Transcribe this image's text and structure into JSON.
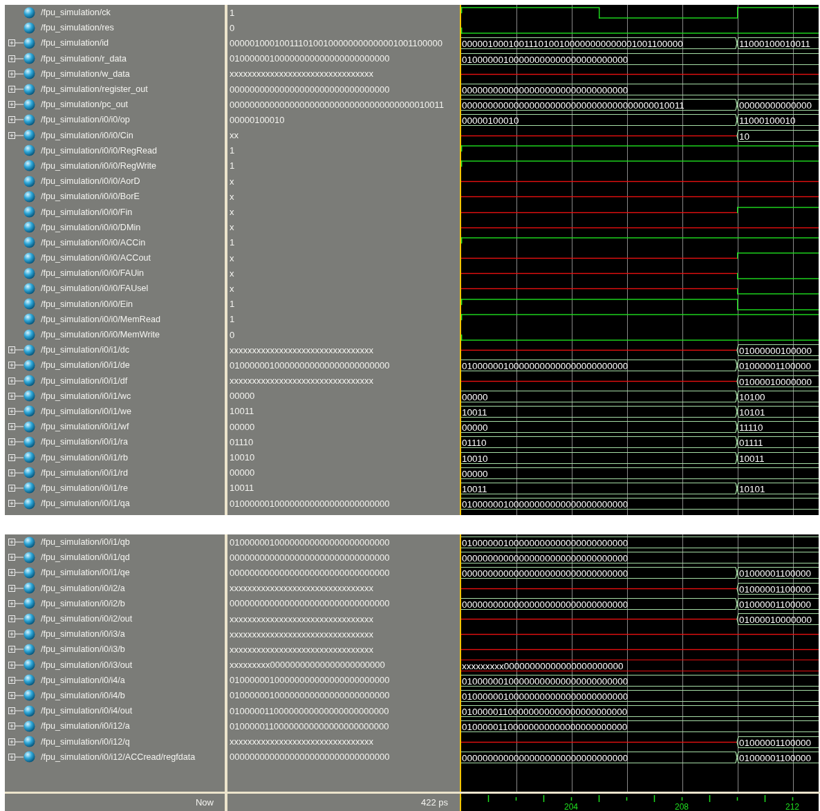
{
  "panes": [
    {
      "signals": [
        {
          "name": "/fpu_simulation/ck",
          "value": "1",
          "expandable": false,
          "kind": "bit",
          "wave": [
            {
              "unknown": false,
              "high": true
            },
            {
              "unknown": false,
              "high": false
            },
            {
              "unknown": false,
              "high": true
            }
          ]
        },
        {
          "name": "/fpu_simulation/res",
          "value": "0",
          "expandable": false,
          "kind": "bit",
          "wave": [
            {
              "unknown": false,
              "high": false
            }
          ]
        },
        {
          "name": "/fpu_simulation/id",
          "value": "0000010001001110100100000000000001001100000",
          "expandable": true,
          "kind": "bus",
          "wave": [
            {
              "unknown": false,
              "partial": false,
              "text": "0000010001001110100100000000000001001100000"
            },
            {
              "unknown": false,
              "partial": false,
              "text": "11000100010011"
            }
          ]
        },
        {
          "name": "/fpu_simulation/r_data",
          "value": "01000000100000000000000000000000",
          "expandable": true,
          "kind": "bus",
          "wave": [
            {
              "unknown": false,
              "partial": false,
              "text": "01000000100000000000000000000000"
            }
          ]
        },
        {
          "name": "/fpu_simulation/w_data",
          "value": "xxxxxxxxxxxxxxxxxxxxxxxxxxxxxxxx",
          "expandable": true,
          "kind": "bus",
          "wave": [
            {
              "unknown": true
            }
          ]
        },
        {
          "name": "/fpu_simulation/register_out",
          "value": "00000000000000000000000000000000",
          "expandable": true,
          "kind": "bus",
          "wave": [
            {
              "unknown": false,
              "partial": false,
              "text": "00000000000000000000000000000000"
            }
          ]
        },
        {
          "name": "/fpu_simulation/pc_out",
          "value": "0000000000000000000000000000000000000010011",
          "expandable": true,
          "kind": "bus",
          "wave": [
            {
              "unknown": false,
              "partial": false,
              "text": "0000000000000000000000000000000000000010011"
            },
            {
              "unknown": false,
              "partial": false,
              "text": "00000000000000"
            }
          ]
        },
        {
          "name": "/fpu_simulation/i0/i0/op",
          "value": "00000100010",
          "expandable": true,
          "kind": "bus",
          "wave": [
            {
              "unknown": false,
              "partial": false,
              "text": "00000100010"
            },
            {
              "unknown": false,
              "partial": false,
              "text": "11000100010"
            }
          ]
        },
        {
          "name": "/fpu_simulation/i0/i0/Cin",
          "value": "xx",
          "expandable": true,
          "kind": "bus",
          "wave": [
            {
              "unknown": true
            },
            {
              "unknown": false,
              "partial": false,
              "text": "10"
            }
          ]
        },
        {
          "name": "/fpu_simulation/i0/i0/RegRead",
          "value": "1",
          "expandable": false,
          "kind": "bit",
          "wave": [
            {
              "unknown": false,
              "high": true
            }
          ]
        },
        {
          "name": "/fpu_simulation/i0/i0/RegWrite",
          "value": "1",
          "expandable": false,
          "kind": "bit",
          "wave": [
            {
              "unknown": false,
              "high": true
            }
          ]
        },
        {
          "name": "/fpu_simulation/i0/i0/AorD",
          "value": "x",
          "expandable": false,
          "kind": "bit",
          "wave": [
            {
              "unknown": true
            }
          ]
        },
        {
          "name": "/fpu_simulation/i0/i0/BorE",
          "value": "x",
          "expandable": false,
          "kind": "bit",
          "wave": [
            {
              "unknown": true
            }
          ]
        },
        {
          "name": "/fpu_simulation/i0/i0/Fin",
          "value": "x",
          "expandable": false,
          "kind": "bit",
          "wave": [
            {
              "unknown": true
            },
            {
              "unknown": false,
              "high": true
            }
          ]
        },
        {
          "name": "/fpu_simulation/i0/i0/DMin",
          "value": "x",
          "expandable": false,
          "kind": "bit",
          "wave": [
            {
              "unknown": true
            }
          ]
        },
        {
          "name": "/fpu_simulation/i0/i0/ACCin",
          "value": "1",
          "expandable": false,
          "kind": "bit",
          "wave": [
            {
              "unknown": false,
              "high": true
            }
          ]
        },
        {
          "name": "/fpu_simulation/i0/i0/ACCout",
          "value": "x",
          "expandable": false,
          "kind": "bit",
          "wave": [
            {
              "unknown": true
            },
            {
              "unknown": false,
              "high": true
            }
          ]
        },
        {
          "name": "/fpu_simulation/i0/i0/FAUin",
          "value": "x",
          "expandable": false,
          "kind": "bit",
          "wave": [
            {
              "unknown": true
            },
            {
              "unknown": false,
              "high": false
            }
          ]
        },
        {
          "name": "/fpu_simulation/i0/i0/FAUsel",
          "value": "x",
          "expandable": false,
          "kind": "bit",
          "wave": [
            {
              "unknown": true
            },
            {
              "unknown": false,
              "high": false
            }
          ]
        },
        {
          "name": "/fpu_simulation/i0/i0/Ein",
          "value": "1",
          "expandable": false,
          "kind": "bit",
          "wave": [
            {
              "unknown": false,
              "high": true
            },
            {
              "unknown": false,
              "high": false
            }
          ]
        },
        {
          "name": "/fpu_simulation/i0/i0/MemRead",
          "value": "1",
          "expandable": false,
          "kind": "bit",
          "wave": [
            {
              "unknown": false,
              "high": true
            }
          ]
        },
        {
          "name": "/fpu_simulation/i0/i0/MemWrite",
          "value": "0",
          "expandable": false,
          "kind": "bit",
          "wave": [
            {
              "unknown": false,
              "high": false
            }
          ]
        },
        {
          "name": "/fpu_simulation/i0/i1/dc",
          "value": "xxxxxxxxxxxxxxxxxxxxxxxxxxxxxxxx",
          "expandable": true,
          "kind": "bus",
          "wave": [
            {
              "unknown": true
            },
            {
              "unknown": false,
              "partial": false,
              "text": "01000000100000"
            }
          ]
        },
        {
          "name": "/fpu_simulation/i0/i1/de",
          "value": "01000000100000000000000000000000",
          "expandable": true,
          "kind": "bus",
          "wave": [
            {
              "unknown": false,
              "partial": false,
              "text": "01000000100000000000000000000000"
            },
            {
              "unknown": false,
              "partial": false,
              "text": "01000001100000"
            }
          ]
        },
        {
          "name": "/fpu_simulation/i0/i1/df",
          "value": "xxxxxxxxxxxxxxxxxxxxxxxxxxxxxxxx",
          "expandable": true,
          "kind": "bus",
          "wave": [
            {
              "unknown": true
            },
            {
              "unknown": false,
              "partial": false,
              "text": "01000010000000"
            }
          ]
        },
        {
          "name": "/fpu_simulation/i0/i1/wc",
          "value": "00000",
          "expandable": true,
          "kind": "bus",
          "wave": [
            {
              "unknown": false,
              "partial": false,
              "text": "00000"
            },
            {
              "unknown": false,
              "partial": false,
              "text": "10100"
            }
          ]
        },
        {
          "name": "/fpu_simulation/i0/i1/we",
          "value": "10011",
          "expandable": true,
          "kind": "bus",
          "wave": [
            {
              "unknown": false,
              "partial": false,
              "text": "10011"
            },
            {
              "unknown": false,
              "partial": false,
              "text": "10101"
            }
          ]
        },
        {
          "name": "/fpu_simulation/i0/i1/wf",
          "value": "00000",
          "expandable": true,
          "kind": "bus",
          "wave": [
            {
              "unknown": false,
              "partial": false,
              "text": "00000"
            },
            {
              "unknown": false,
              "partial": false,
              "text": "11110"
            }
          ]
        },
        {
          "name": "/fpu_simulation/i0/i1/ra",
          "value": "01110",
          "expandable": true,
          "kind": "bus",
          "wave": [
            {
              "unknown": false,
              "partial": false,
              "text": "01110"
            },
            {
              "unknown": false,
              "partial": false,
              "text": "01111"
            }
          ]
        },
        {
          "name": "/fpu_simulation/i0/i1/rb",
          "value": "10010",
          "expandable": true,
          "kind": "bus",
          "wave": [
            {
              "unknown": false,
              "partial": false,
              "text": "10010"
            },
            {
              "unknown": false,
              "partial": false,
              "text": "10011"
            }
          ]
        },
        {
          "name": "/fpu_simulation/i0/i1/rd",
          "value": "00000",
          "expandable": true,
          "kind": "bus",
          "wave": [
            {
              "unknown": false,
              "partial": false,
              "text": "00000"
            }
          ]
        },
        {
          "name": "/fpu_simulation/i0/i1/re",
          "value": "10011",
          "expandable": true,
          "kind": "bus",
          "wave": [
            {
              "unknown": false,
              "partial": false,
              "text": "10011"
            },
            {
              "unknown": false,
              "partial": false,
              "text": "10101"
            }
          ]
        },
        {
          "name": "/fpu_simulation/i0/i1/qa",
          "value": "01000000100000000000000000000000",
          "expandable": true,
          "kind": "bus",
          "wave": [
            {
              "unknown": false,
              "partial": false,
              "text": "01000000100000000000000000000000"
            }
          ]
        }
      ]
    },
    {
      "signals": [
        {
          "name": "/fpu_simulation/i0/i1/qb",
          "value": "01000000100000000000000000000000",
          "expandable": true,
          "kind": "bus",
          "wave": [
            {
              "unknown": false,
              "partial": false,
              "text": "01000000100000000000000000000000"
            }
          ]
        },
        {
          "name": "/fpu_simulation/i0/i1/qd",
          "value": "00000000000000000000000000000000",
          "expandable": true,
          "kind": "bus",
          "wave": [
            {
              "unknown": false,
              "partial": false,
              "text": "00000000000000000000000000000000"
            }
          ]
        },
        {
          "name": "/fpu_simulation/i0/i1/qe",
          "value": "00000000000000000000000000000000",
          "expandable": true,
          "kind": "bus",
          "wave": [
            {
              "unknown": false,
              "partial": false,
              "text": "00000000000000000000000000000000"
            },
            {
              "unknown": false,
              "partial": false,
              "text": "01000001100000"
            }
          ]
        },
        {
          "name": "/fpu_simulation/i0/i2/a",
          "value": "xxxxxxxxxxxxxxxxxxxxxxxxxxxxxxxx",
          "expandable": true,
          "kind": "bus",
          "wave": [
            {
              "unknown": true
            },
            {
              "unknown": false,
              "partial": false,
              "text": "01000001100000"
            }
          ]
        },
        {
          "name": "/fpu_simulation/i0/i2/b",
          "value": "00000000000000000000000000000000",
          "expandable": true,
          "kind": "bus",
          "wave": [
            {
              "unknown": false,
              "partial": false,
              "text": "00000000000000000000000000000000"
            },
            {
              "unknown": false,
              "partial": false,
              "text": "01000001100000"
            }
          ]
        },
        {
          "name": "/fpu_simulation/i0/i2/out",
          "value": "xxxxxxxxxxxxxxxxxxxxxxxxxxxxxxxx",
          "expandable": true,
          "kind": "bus",
          "wave": [
            {
              "unknown": true
            },
            {
              "unknown": false,
              "partial": false,
              "text": "01000010000000"
            }
          ]
        },
        {
          "name": "/fpu_simulation/i0/i3/a",
          "value": "xxxxxxxxxxxxxxxxxxxxxxxxxxxxxxxx",
          "expandable": true,
          "kind": "bus",
          "wave": [
            {
              "unknown": true
            }
          ]
        },
        {
          "name": "/fpu_simulation/i0/i3/b",
          "value": "xxxxxxxxxxxxxxxxxxxxxxxxxxxxxxxx",
          "expandable": true,
          "kind": "bus",
          "wave": [
            {
              "unknown": true
            }
          ]
        },
        {
          "name": "/fpu_simulation/i0/i3/out",
          "value": "xxxxxxxxx00000000000000000000000",
          "expandable": true,
          "kind": "bus",
          "wave": [
            {
              "unknown": false,
              "partial": true,
              "text": "xxxxxxxxx00000000000000000000000"
            }
          ]
        },
        {
          "name": "/fpu_simulation/i0/i4/a",
          "value": "01000000100000000000000000000000",
          "expandable": true,
          "kind": "bus",
          "wave": [
            {
              "unknown": false,
              "partial": false,
              "text": "01000000100000000000000000000000"
            }
          ]
        },
        {
          "name": "/fpu_simulation/i0/i4/b",
          "value": "01000000100000000000000000000000",
          "expandable": true,
          "kind": "bus",
          "wave": [
            {
              "unknown": false,
              "partial": false,
              "text": "01000000100000000000000000000000"
            }
          ]
        },
        {
          "name": "/fpu_simulation/i0/i4/out",
          "value": "01000001100000000000000000000000",
          "expandable": true,
          "kind": "bus",
          "wave": [
            {
              "unknown": false,
              "partial": false,
              "text": "01000001100000000000000000000000"
            }
          ]
        },
        {
          "name": "/fpu_simulation/i0/i12/a",
          "value": "01000001100000000000000000000000",
          "expandable": true,
          "kind": "bus",
          "wave": [
            {
              "unknown": false,
              "partial": false,
              "text": "01000001100000000000000000000000"
            }
          ]
        },
        {
          "name": "/fpu_simulation/i0/i12/q",
          "value": "xxxxxxxxxxxxxxxxxxxxxxxxxxxxxxxx",
          "expandable": true,
          "kind": "bus",
          "wave": [
            {
              "unknown": true
            },
            {
              "unknown": false,
              "partial": false,
              "text": "01000001100000"
            }
          ]
        },
        {
          "name": "/fpu_simulation/i0/i12/ACCread/regfdata",
          "value": "00000000000000000000000000000000",
          "expandable": true,
          "kind": "bus",
          "wave": [
            {
              "unknown": false,
              "partial": false,
              "text": "00000000000000000000000000000000"
            },
            {
              "unknown": false,
              "partial": false,
              "text": "01000001100000"
            }
          ]
        }
      ]
    }
  ],
  "footer": {
    "now_label": "Now",
    "now_time": "422 ps",
    "time_labels": [
      "204",
      "208",
      "212"
    ]
  }
}
